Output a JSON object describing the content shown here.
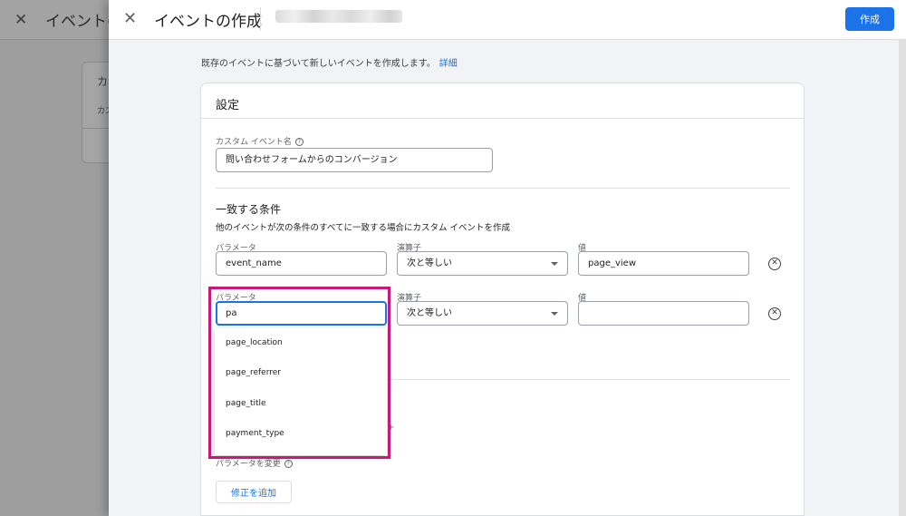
{
  "background": {
    "title": "イベントの",
    "card_line1": "カ",
    "card_line2": "カス"
  },
  "header": {
    "title": "イベントの作成",
    "create_button": "作成"
  },
  "intro": {
    "text": "既存のイベントに基づいて新しいイベントを作成します。",
    "link": "詳細"
  },
  "settings": {
    "title": "設定",
    "custom_event_label": "カスタム イベント名",
    "custom_event_value": "問い合わせフォームからのコンバージョン"
  },
  "conditions": {
    "title": "一致する条件",
    "description": "他のイベントが次の条件のすべてに一致する場合にカスタム イベントを作成",
    "rows": [
      {
        "param_label": "パラメータ",
        "param_value": "event_name",
        "op_label": "演算子",
        "op_value": "次と等しい",
        "val_label": "値",
        "val_value": "page_view"
      },
      {
        "param_label": "パラメータ",
        "param_value": "pa",
        "op_label": "演算子",
        "op_value": "次と等しい",
        "val_label": "値",
        "val_value": ""
      }
    ]
  },
  "suggestions": [
    "page_location",
    "page_referrer",
    "page_title",
    "payment_type"
  ],
  "modify": {
    "label": "パラメータを変更",
    "add_button": "修正を追加"
  },
  "colors": {
    "accent": "#1a73e8",
    "highlight": "#c8187a"
  }
}
